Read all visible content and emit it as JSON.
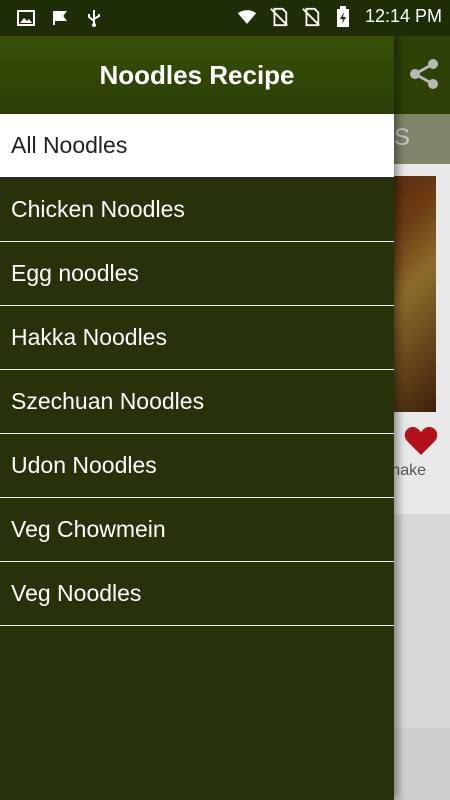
{
  "status_bar": {
    "icons_left": [
      "image-icon",
      "flag-icon",
      "usb-icon"
    ],
    "icons_right": [
      "wifi-icon",
      "no-sim-icon",
      "no-sim-icon",
      "battery-charging-icon"
    ],
    "time": "12:14 PM"
  },
  "drawer": {
    "title": "Noodles Recipe",
    "items": [
      {
        "label": "All Noodles",
        "active": true
      },
      {
        "label": "Chicken Noodles"
      },
      {
        "label": "Egg noodles"
      },
      {
        "label": "Hakka Noodles"
      },
      {
        "label": "Szechuan Noodles"
      },
      {
        "label": "Udon Noodles"
      },
      {
        "label": "Veg Chowmein"
      },
      {
        "label": "Veg Noodles"
      }
    ]
  },
  "background": {
    "tab_label_fragment": "S",
    "card_action_label": "hake",
    "icons": [
      "share-icon",
      "heart-icon"
    ]
  },
  "colors": {
    "drawer_bg": "#28320a",
    "header_green": "#355006",
    "heart": "#b3121a",
    "active_item_bg": "#ffffff"
  }
}
